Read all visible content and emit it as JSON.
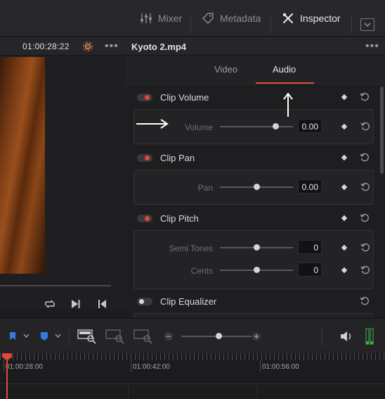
{
  "toolbar": {
    "mixer_label": "Mixer",
    "metadata_label": "Metadata",
    "inspector_label": "Inspector"
  },
  "viewer": {
    "timecode": "01:00:28:22"
  },
  "inspector": {
    "clip_name": "Kyoto 2.mp4",
    "tabs": [
      "Video",
      "Audio"
    ],
    "active_tab": "Audio",
    "sections": {
      "volume": {
        "title": "Clip Volume",
        "enabled": true,
        "param": "Volume",
        "value": "0.00"
      },
      "pan": {
        "title": "Clip Pan",
        "enabled": true,
        "param": "Pan",
        "value": "0.00"
      },
      "pitch": {
        "title": "Clip Pitch",
        "enabled": true,
        "semitones_label": "Semi Tones",
        "semitones_value": "0",
        "cents_label": "Cents",
        "cents_value": "0"
      },
      "equalizer": {
        "title": "Clip Equalizer",
        "enabled": false
      }
    }
  },
  "timeline": {
    "timecodes": [
      "01:00:28:00",
      "01:00:42:00",
      "01:00:56:00"
    ]
  },
  "colors": {
    "accent": "#e2473a",
    "panel": "#1e1e20",
    "box": "#232326"
  }
}
